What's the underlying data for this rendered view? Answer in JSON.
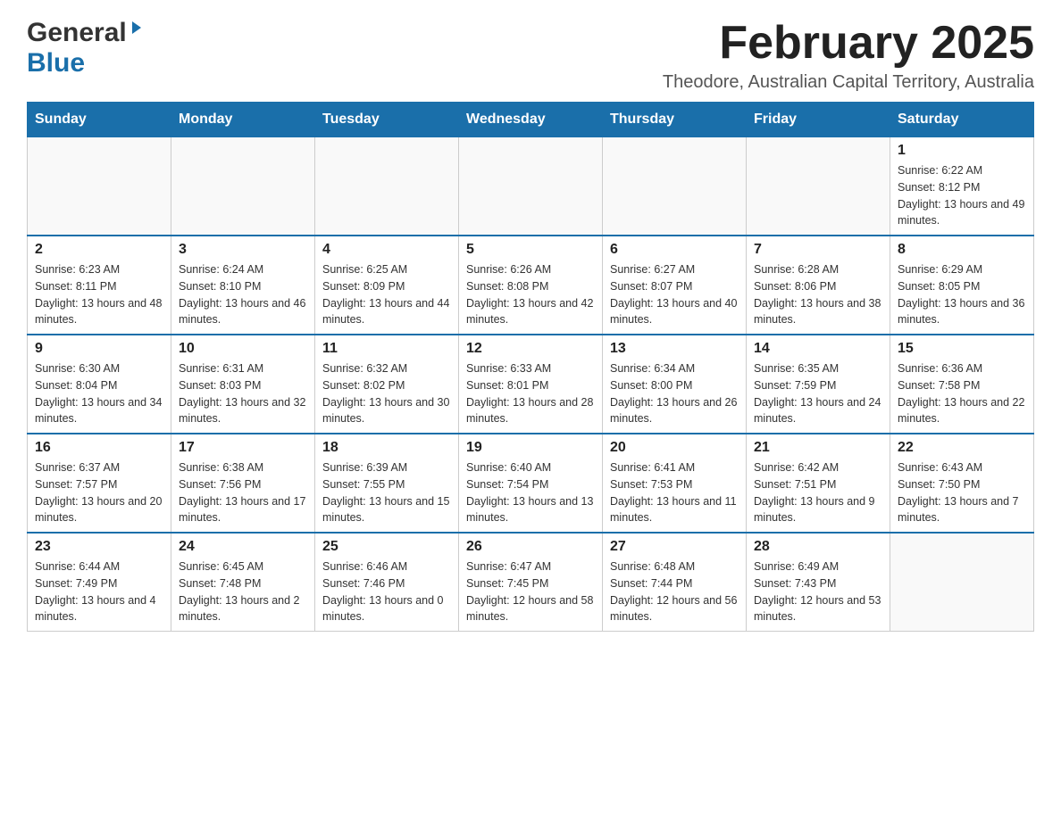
{
  "logo": {
    "general": "General",
    "blue": "Blue"
  },
  "header": {
    "title": "February 2025",
    "location": "Theodore, Australian Capital Territory, Australia"
  },
  "weekdays": [
    "Sunday",
    "Monday",
    "Tuesday",
    "Wednesday",
    "Thursday",
    "Friday",
    "Saturday"
  ],
  "weeks": [
    [
      {
        "day": "",
        "info": ""
      },
      {
        "day": "",
        "info": ""
      },
      {
        "day": "",
        "info": ""
      },
      {
        "day": "",
        "info": ""
      },
      {
        "day": "",
        "info": ""
      },
      {
        "day": "",
        "info": ""
      },
      {
        "day": "1",
        "info": "Sunrise: 6:22 AM\nSunset: 8:12 PM\nDaylight: 13 hours and 49 minutes."
      }
    ],
    [
      {
        "day": "2",
        "info": "Sunrise: 6:23 AM\nSunset: 8:11 PM\nDaylight: 13 hours and 48 minutes."
      },
      {
        "day": "3",
        "info": "Sunrise: 6:24 AM\nSunset: 8:10 PM\nDaylight: 13 hours and 46 minutes."
      },
      {
        "day": "4",
        "info": "Sunrise: 6:25 AM\nSunset: 8:09 PM\nDaylight: 13 hours and 44 minutes."
      },
      {
        "day": "5",
        "info": "Sunrise: 6:26 AM\nSunset: 8:08 PM\nDaylight: 13 hours and 42 minutes."
      },
      {
        "day": "6",
        "info": "Sunrise: 6:27 AM\nSunset: 8:07 PM\nDaylight: 13 hours and 40 minutes."
      },
      {
        "day": "7",
        "info": "Sunrise: 6:28 AM\nSunset: 8:06 PM\nDaylight: 13 hours and 38 minutes."
      },
      {
        "day": "8",
        "info": "Sunrise: 6:29 AM\nSunset: 8:05 PM\nDaylight: 13 hours and 36 minutes."
      }
    ],
    [
      {
        "day": "9",
        "info": "Sunrise: 6:30 AM\nSunset: 8:04 PM\nDaylight: 13 hours and 34 minutes."
      },
      {
        "day": "10",
        "info": "Sunrise: 6:31 AM\nSunset: 8:03 PM\nDaylight: 13 hours and 32 minutes."
      },
      {
        "day": "11",
        "info": "Sunrise: 6:32 AM\nSunset: 8:02 PM\nDaylight: 13 hours and 30 minutes."
      },
      {
        "day": "12",
        "info": "Sunrise: 6:33 AM\nSunset: 8:01 PM\nDaylight: 13 hours and 28 minutes."
      },
      {
        "day": "13",
        "info": "Sunrise: 6:34 AM\nSunset: 8:00 PM\nDaylight: 13 hours and 26 minutes."
      },
      {
        "day": "14",
        "info": "Sunrise: 6:35 AM\nSunset: 7:59 PM\nDaylight: 13 hours and 24 minutes."
      },
      {
        "day": "15",
        "info": "Sunrise: 6:36 AM\nSunset: 7:58 PM\nDaylight: 13 hours and 22 minutes."
      }
    ],
    [
      {
        "day": "16",
        "info": "Sunrise: 6:37 AM\nSunset: 7:57 PM\nDaylight: 13 hours and 20 minutes."
      },
      {
        "day": "17",
        "info": "Sunrise: 6:38 AM\nSunset: 7:56 PM\nDaylight: 13 hours and 17 minutes."
      },
      {
        "day": "18",
        "info": "Sunrise: 6:39 AM\nSunset: 7:55 PM\nDaylight: 13 hours and 15 minutes."
      },
      {
        "day": "19",
        "info": "Sunrise: 6:40 AM\nSunset: 7:54 PM\nDaylight: 13 hours and 13 minutes."
      },
      {
        "day": "20",
        "info": "Sunrise: 6:41 AM\nSunset: 7:53 PM\nDaylight: 13 hours and 11 minutes."
      },
      {
        "day": "21",
        "info": "Sunrise: 6:42 AM\nSunset: 7:51 PM\nDaylight: 13 hours and 9 minutes."
      },
      {
        "day": "22",
        "info": "Sunrise: 6:43 AM\nSunset: 7:50 PM\nDaylight: 13 hours and 7 minutes."
      }
    ],
    [
      {
        "day": "23",
        "info": "Sunrise: 6:44 AM\nSunset: 7:49 PM\nDaylight: 13 hours and 4 minutes."
      },
      {
        "day": "24",
        "info": "Sunrise: 6:45 AM\nSunset: 7:48 PM\nDaylight: 13 hours and 2 minutes."
      },
      {
        "day": "25",
        "info": "Sunrise: 6:46 AM\nSunset: 7:46 PM\nDaylight: 13 hours and 0 minutes."
      },
      {
        "day": "26",
        "info": "Sunrise: 6:47 AM\nSunset: 7:45 PM\nDaylight: 12 hours and 58 minutes."
      },
      {
        "day": "27",
        "info": "Sunrise: 6:48 AM\nSunset: 7:44 PM\nDaylight: 12 hours and 56 minutes."
      },
      {
        "day": "28",
        "info": "Sunrise: 6:49 AM\nSunset: 7:43 PM\nDaylight: 12 hours and 53 minutes."
      },
      {
        "day": "",
        "info": ""
      }
    ]
  ]
}
